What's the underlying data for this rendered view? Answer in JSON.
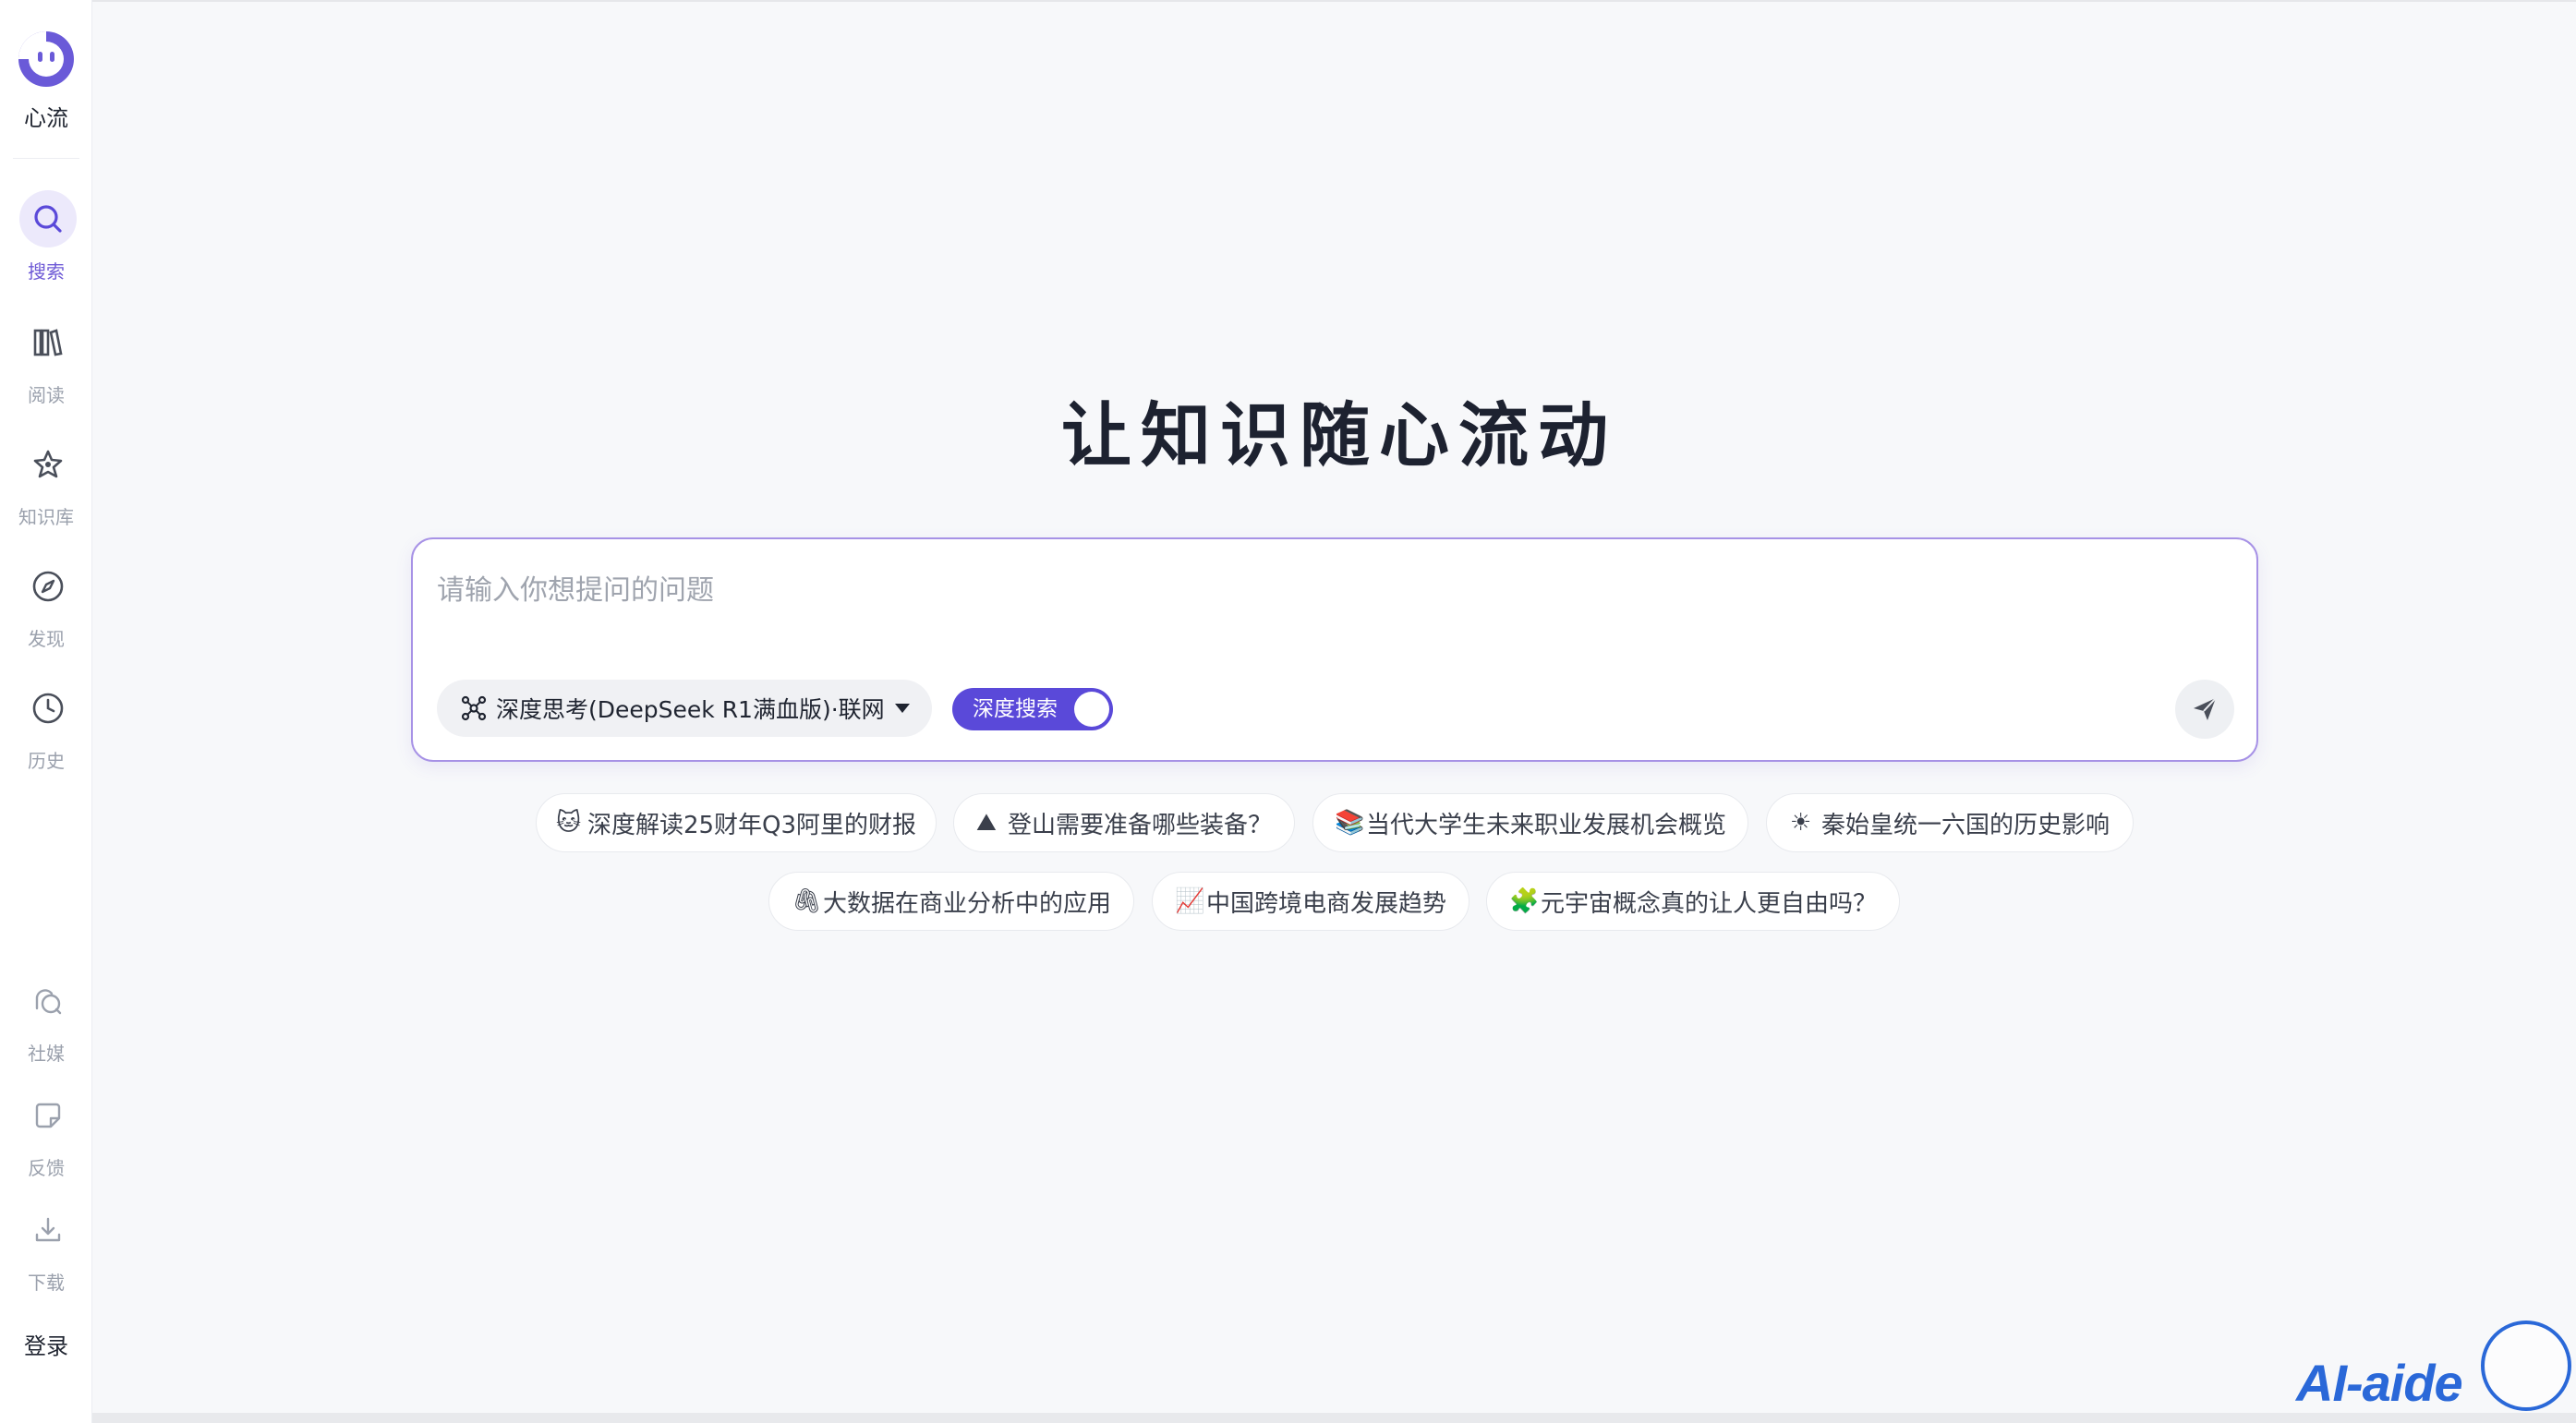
{
  "app": {
    "name": "心流",
    "hero_title": "让知识随心流动"
  },
  "sidebar": {
    "nav_top": [
      {
        "label": "搜索",
        "icon": "search-icon",
        "active": true
      },
      {
        "label": "阅读",
        "icon": "books-icon",
        "active": false
      },
      {
        "label": "知识库",
        "icon": "knowledge-icon",
        "active": false
      },
      {
        "label": "发现",
        "icon": "compass-icon",
        "active": false
      },
      {
        "label": "历史",
        "icon": "clock-icon",
        "active": false
      }
    ],
    "nav_bottom": [
      {
        "label": "社媒",
        "icon": "social-icon"
      },
      {
        "label": "反馈",
        "icon": "feedback-icon"
      },
      {
        "label": "下载",
        "icon": "download-icon"
      }
    ],
    "login_label": "登录"
  },
  "search": {
    "placeholder": "请输入你想提问的问题",
    "value": "",
    "model_label": "深度思考(DeepSeek R1满血版)·联网",
    "deep_search_label": "深度搜索",
    "deep_search_on": true
  },
  "suggestions": [
    {
      "emoji": "🐱",
      "text": "深度解读25财年Q3阿里的财报"
    },
    {
      "emoji": "⛰",
      "text": "登山需要准备哪些装备？"
    },
    {
      "emoji": "📚",
      "text": "当代大学生未来职业发展机会概览"
    },
    {
      "emoji": "☀",
      "text": "秦始皇统一六国的历史影响"
    },
    {
      "emoji": "🖇",
      "text": "大数据在商业分析中的应用"
    },
    {
      "emoji": "📈",
      "text": "中国跨境电商发展趋势"
    },
    {
      "emoji": "🧩",
      "text": "元宇宙概念真的让人更自由吗？"
    }
  ],
  "watermark": {
    "text": "AI-aide"
  },
  "colors": {
    "accent": "#5a49d9",
    "accent_light": "#ece9fb",
    "border_accent": "#a792e6",
    "background": "#f7f8fa"
  }
}
